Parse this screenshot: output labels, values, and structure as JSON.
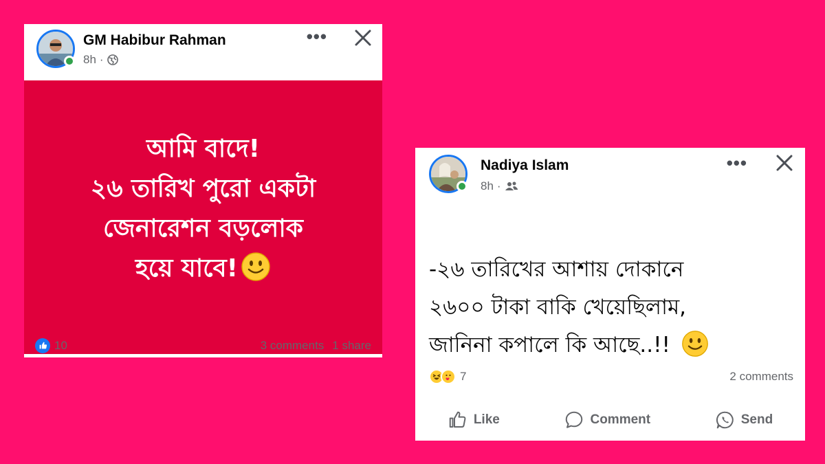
{
  "post1": {
    "author": "GM Habibur Rahman",
    "time": "8h",
    "privacy_icon": "globe-icon",
    "message_lines": [
      "আমি বাদে!",
      "২৬ তারিখ পুরো একটা",
      "জেনারেশন বড়লোক",
      "হয়ে যাবে!"
    ],
    "reaction_count": "10",
    "comments": "3 comments",
    "shares": "1 share",
    "background_color": "#e0003c"
  },
  "post2": {
    "author": "Nadiya Islam",
    "time": "8h",
    "privacy_icon": "friends-icon",
    "message_lines": [
      "-২৬ তারিখের আশায় দোকানে",
      "২৬০০ টাকা বাকি খেয়েছিলাম,",
      "জানিনা কপালে কি আছে..!!"
    ],
    "reaction_count": "7",
    "comments": "2 comments",
    "actions": {
      "like": "Like",
      "comment": "Comment",
      "send": "Send"
    }
  },
  "colors": {
    "page_background": "#ff0f6e",
    "facebook_blue": "#1877f2",
    "online_green": "#31a24c"
  }
}
